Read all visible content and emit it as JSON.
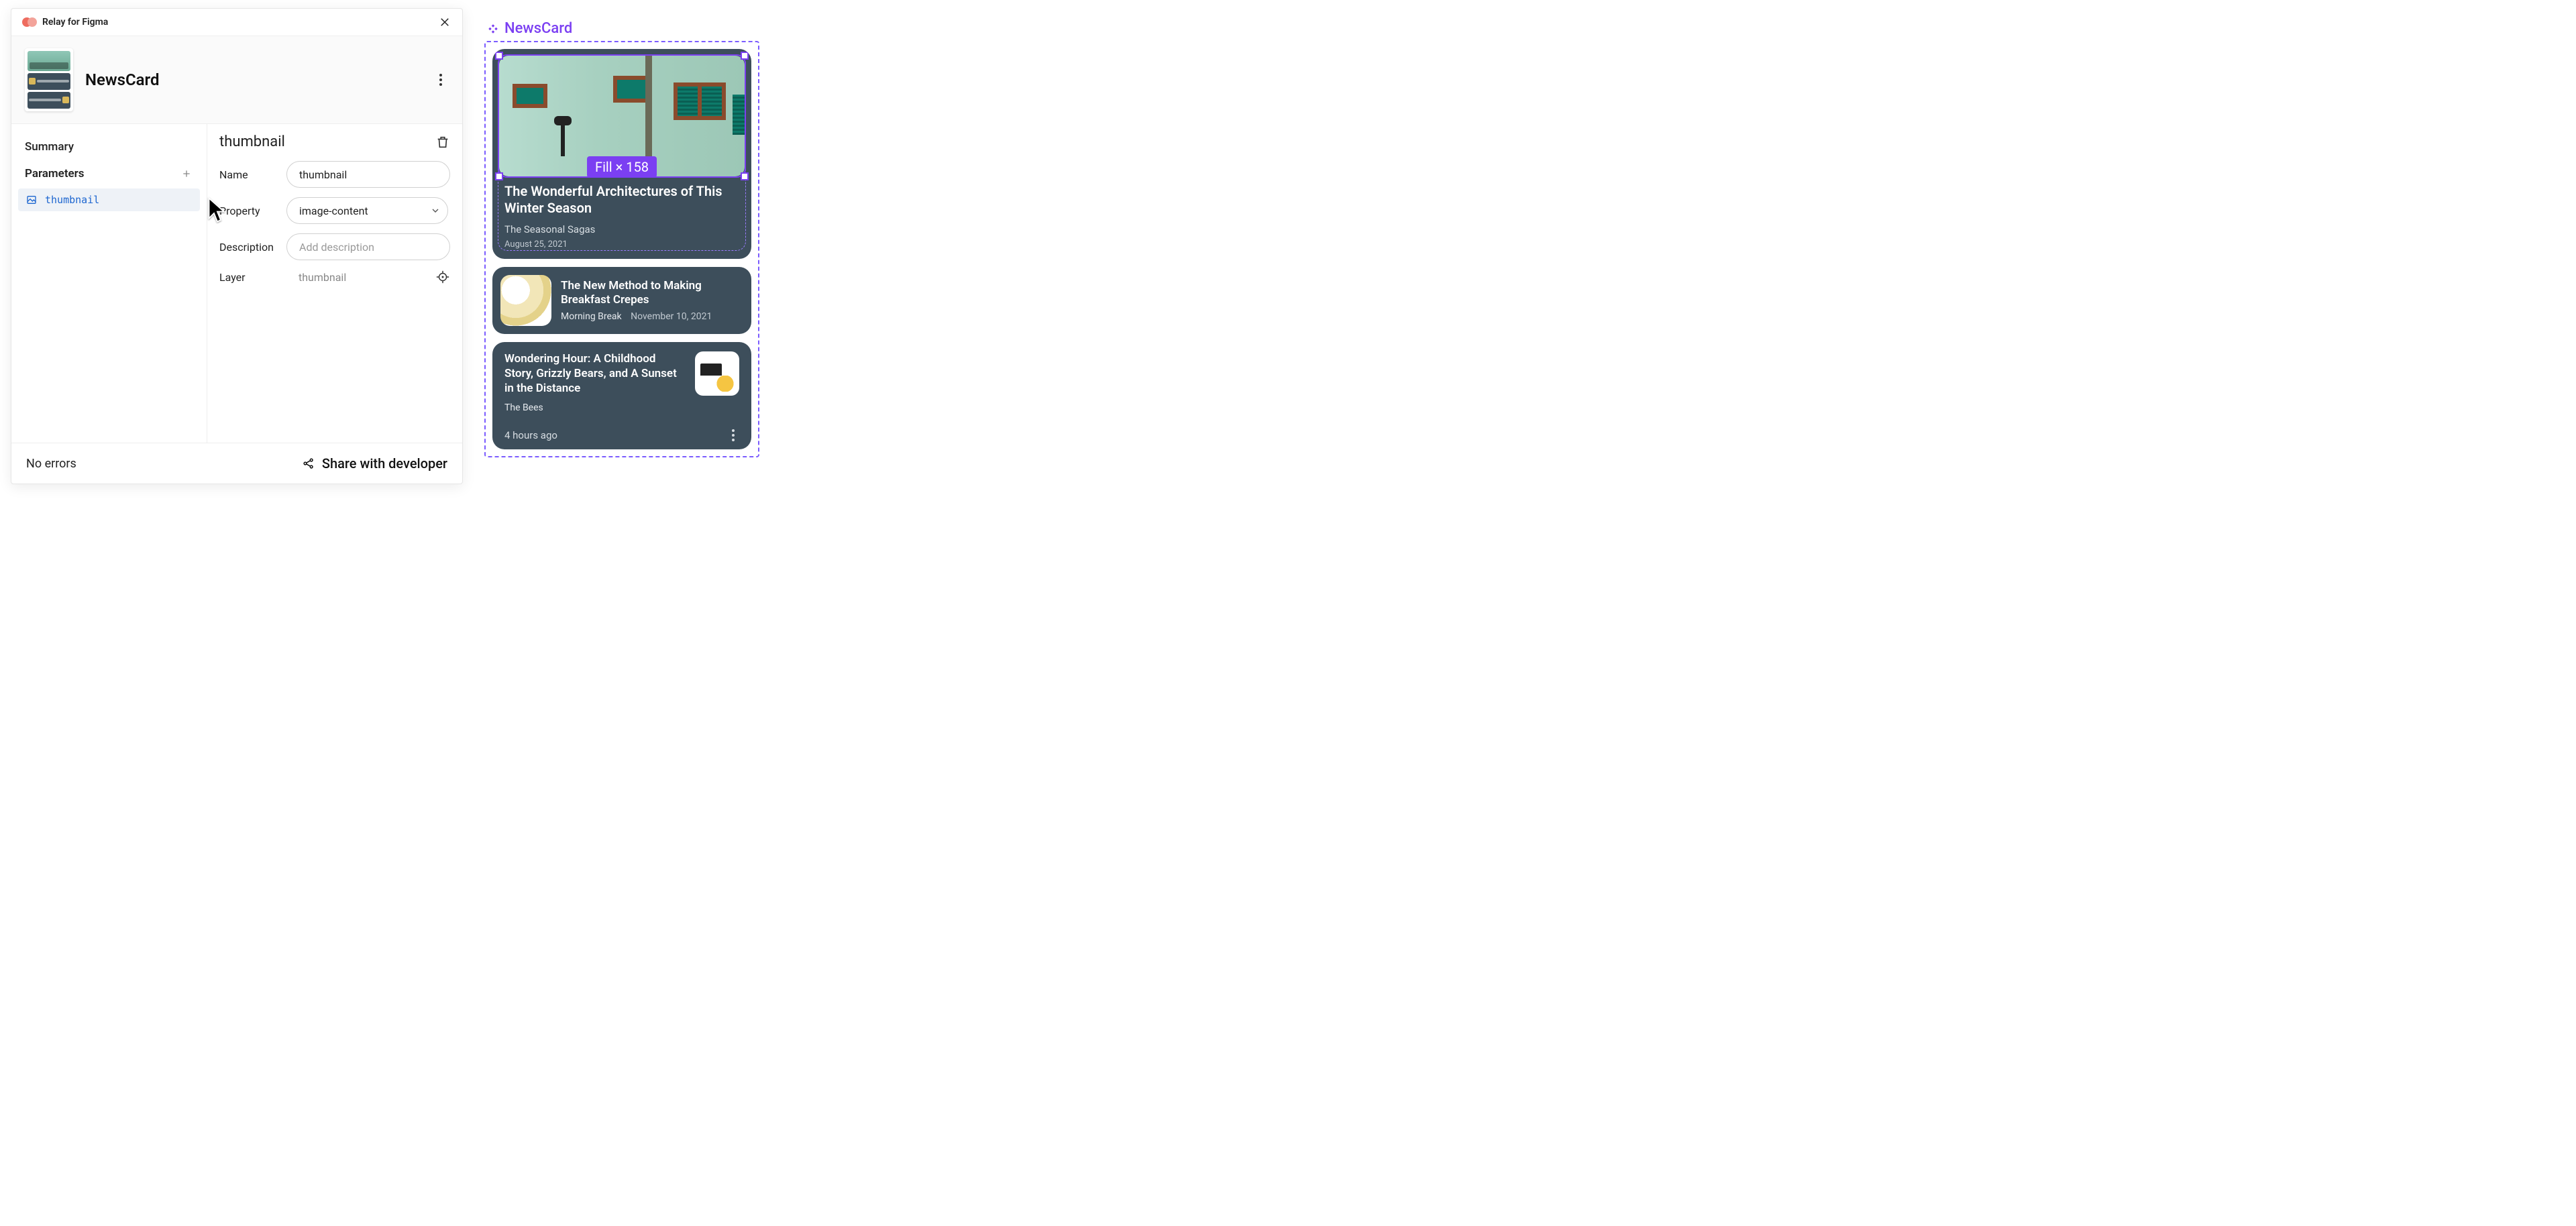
{
  "plugin": {
    "title": "Relay for Figma",
    "component_name": "NewsCard",
    "nav": {
      "summary": "Summary",
      "parameters": "Parameters"
    },
    "params": [
      {
        "label": "thumbnail"
      }
    ],
    "detail": {
      "title": "thumbnail",
      "rows": {
        "name_label": "Name",
        "name_value": "thumbnail",
        "property_label": "Property",
        "property_value": "image-content",
        "description_label": "Description",
        "description_placeholder": "Add description",
        "layer_label": "Layer",
        "layer_value": "thumbnail"
      }
    },
    "footer": {
      "status": "No errors",
      "share": "Share with developer"
    }
  },
  "canvas": {
    "component_label": "NewsCard",
    "size_label": "Fill × 158",
    "cards": {
      "hero": {
        "title": "The Wonderful Architectures of This Winter Season",
        "source": "The Seasonal Sagas",
        "date": "August 25, 2021"
      },
      "row": {
        "title": "The New Method to Making Breakfast Crepes",
        "source": "Morning Break",
        "date": "November 10, 2021"
      },
      "col": {
        "title": "Wondering Hour: A Childhood Story, Grizzly Bears, and A Sunset in the Distance",
        "source": "The Bees",
        "time": "4 hours ago"
      }
    }
  }
}
